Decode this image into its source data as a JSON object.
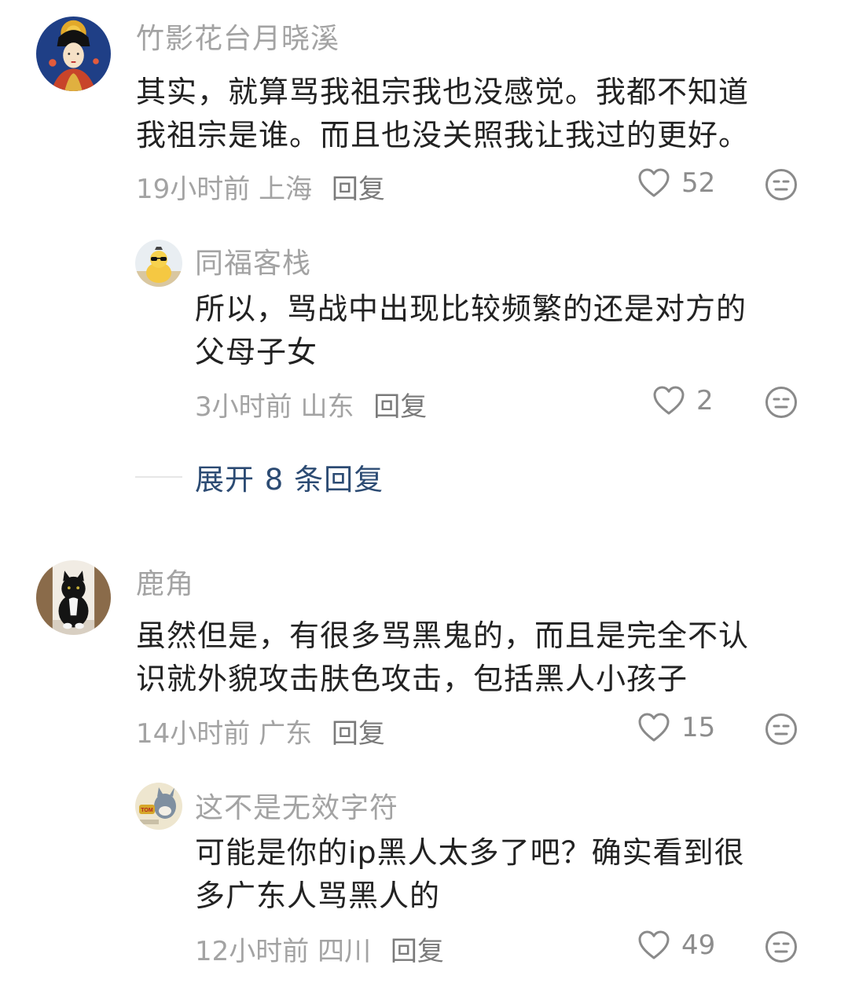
{
  "comments": [
    {
      "user": "竹影花台月晓溪",
      "avatar_icon": "tang-lady-portrait-avatar",
      "lines": [
        "其实，就算骂我祖宗我也没感觉。我都不知道",
        "我祖宗是谁。而且也没关照我让我过的更好。"
      ],
      "time": "19小时前",
      "location": "上海",
      "reply_label": "回复",
      "likes": "52",
      "replies": [
        {
          "user": "同福客栈",
          "avatar_icon": "duck-sunglasses-avatar",
          "lines": [
            "所以，骂战中出现比较频繁的还是对方的",
            "父母子女"
          ],
          "time": "3小时前",
          "location": "山东",
          "reply_label": "回复",
          "likes": "2"
        }
      ],
      "expand_label": "展开 8 条回复"
    },
    {
      "user": "鹿角",
      "avatar_icon": "black-cat-avatar",
      "lines": [
        "虽然但是，有很多骂黑鬼的，而且是完全不认",
        "识就外貌攻击肤色攻击，包括黑人小孩子"
      ],
      "time": "14小时前",
      "location": "广东",
      "reply_label": "回复",
      "likes": "15",
      "replies": [
        {
          "user": "这不是无效字符",
          "avatar_icon": "tom-cat-cartoon-avatar",
          "lines": [
            "可能是你的ip黑人太多了吧？确实看到很",
            "多广东人骂黑人的"
          ],
          "time": "12小时前",
          "location": "四川",
          "reply_label": "回复",
          "likes": "49"
        }
      ]
    }
  ],
  "icons": {
    "like": "heart-outline-icon",
    "dislike": "neutral-face-icon"
  },
  "colors": {
    "name": "#a3a3a3",
    "content": "#222222",
    "meta": "#a3a3a3",
    "expand": "#2c4b73"
  }
}
